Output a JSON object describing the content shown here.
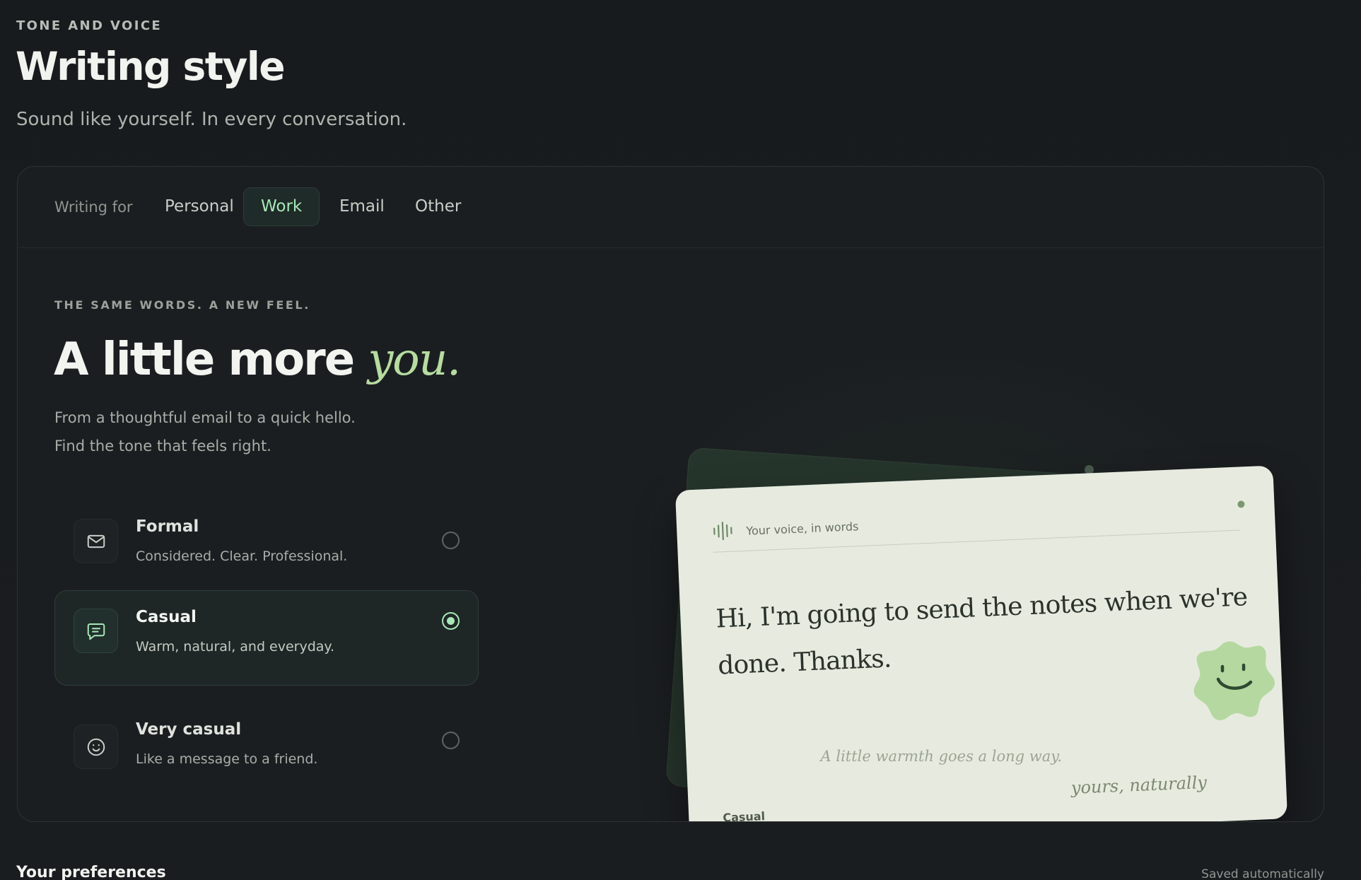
{
  "header": {
    "eyebrow": "TONE AND VOICE",
    "title": "Writing style",
    "subtitle": "Sound like yourself. In every conversation."
  },
  "tabs": {
    "label": "Writing for",
    "items": [
      {
        "label": "Personal",
        "active": false
      },
      {
        "label": "Work",
        "active": true
      },
      {
        "label": "Email",
        "active": false
      },
      {
        "label": "Other",
        "active": false
      }
    ]
  },
  "section": {
    "eyebrow": "THE SAME WORDS. A NEW FEEL.",
    "hero_main": "A little more ",
    "hero_accent": "you.",
    "desc_line1": "From a thoughtful email to a quick hello.",
    "desc_line2": "Find the tone that feels right."
  },
  "options": [
    {
      "title": "Formal",
      "desc": "Considered. Clear. Professional.",
      "icon": "envelope-icon",
      "selected": false
    },
    {
      "title": "Casual",
      "desc": "Warm, natural, and everyday.",
      "icon": "chat-bubble-icon",
      "selected": true
    },
    {
      "title": "Very casual",
      "desc": "Like a message to a friend.",
      "icon": "smiley-icon",
      "selected": false
    }
  ],
  "preview": {
    "label": "Your voice, in words",
    "message": "Hi, I'm going to send the notes when we're done. Thanks.",
    "tag": "Casual",
    "signature": "yours, naturally",
    "caption": "A little warmth goes a long way."
  },
  "preferences": {
    "title": "Your preferences",
    "status": "Saved automatically"
  },
  "colors": {
    "accent": "#a8e7b7",
    "hero_accent": "#b6dca0",
    "card": "#e7ebdf",
    "smiley": "#b5d8a0"
  }
}
